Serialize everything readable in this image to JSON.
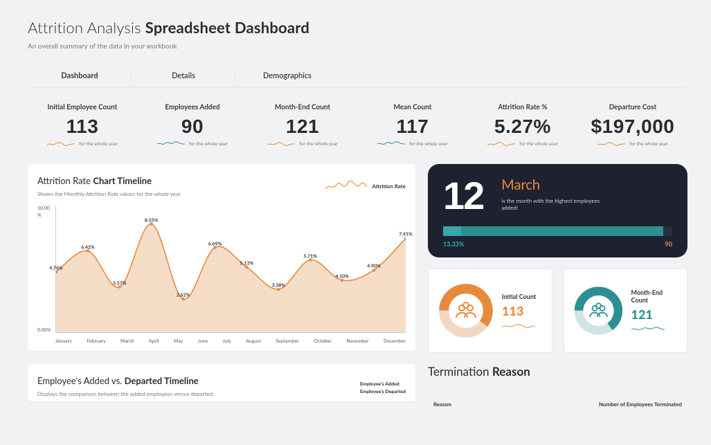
{
  "header": {
    "title_light": "Attrition Analysis ",
    "title_bold": "Spreadsheet Dashboard",
    "subtitle": "An overall summary of the data in your workbook"
  },
  "tabs": [
    {
      "label": "Dashboard",
      "active": true
    },
    {
      "label": "Details",
      "active": false
    },
    {
      "label": "Demographics",
      "active": false
    }
  ],
  "kpi_footnote": "for the whole year",
  "kpis": [
    {
      "label": "Initial Employee Count",
      "value": "113"
    },
    {
      "label": "Employees Added",
      "value": "90"
    },
    {
      "label": "Month-End Count",
      "value": "121"
    },
    {
      "label": "Mean Count",
      "value": "117"
    },
    {
      "label": "Attrition Rate %",
      "value": "5.27%"
    },
    {
      "label": "Departure Cost",
      "value": "$197,000"
    }
  ],
  "attrition_card": {
    "title_light": "Attrition Rate ",
    "title_bold": "Chart Timeline",
    "subtitle": "Shows the Monthly Attrition Rate values for the whole year",
    "legend_label": "Attrition Rate",
    "y_top": "10.00",
    "y_top_unit": "%",
    "y_bottom": "0.00%"
  },
  "highlight": {
    "big_number": "12",
    "month": "March",
    "desc": "is the month with the highest employees added!",
    "pct": "13.33%",
    "total": "90"
  },
  "donuts": {
    "initial": {
      "label": "Initial Count",
      "value": "113"
    },
    "monthend": {
      "label": "Month-End Count",
      "value": "121"
    }
  },
  "added_vs_departed": {
    "title_light": "Employee's Added vs. ",
    "title_bold": "Departed Timeline",
    "subtitle": "Displays the comparison between the added employees versus departed.",
    "legend1": "Employee's Added",
    "legend2": "Employee's Departed"
  },
  "termination": {
    "title_light": "Termination ",
    "title_bold": "Reason",
    "col1": "Reason",
    "col2": "Number of Employees Terminated"
  },
  "chart_data": {
    "type": "area",
    "title": "Attrition Rate Chart Timeline",
    "ylabel": "Attrition Rate %",
    "ylim": [
      0,
      10
    ],
    "categories": [
      "January",
      "February",
      "March",
      "April",
      "May",
      "June",
      "July",
      "August",
      "September",
      "October",
      "November",
      "December"
    ],
    "series": [
      {
        "name": "Attrition Rate",
        "values": [
          4.76,
          6.42,
          3.57,
          8.55,
          2.62,
          6.69,
          5.13,
          3.38,
          5.71,
          4.1,
          4.9,
          7.41
        ],
        "labels": [
          "4.76%",
          "6.42%",
          "3.57%",
          "8.55%",
          "2.62%",
          "6.69%",
          "5.13%",
          "3.38%",
          "5.71%",
          "4.10%",
          "4.90%",
          "7.41%"
        ]
      }
    ]
  },
  "colors": {
    "orange": "#e78a3e",
    "teal": "#2e8f93",
    "dark": "#1e2230"
  }
}
